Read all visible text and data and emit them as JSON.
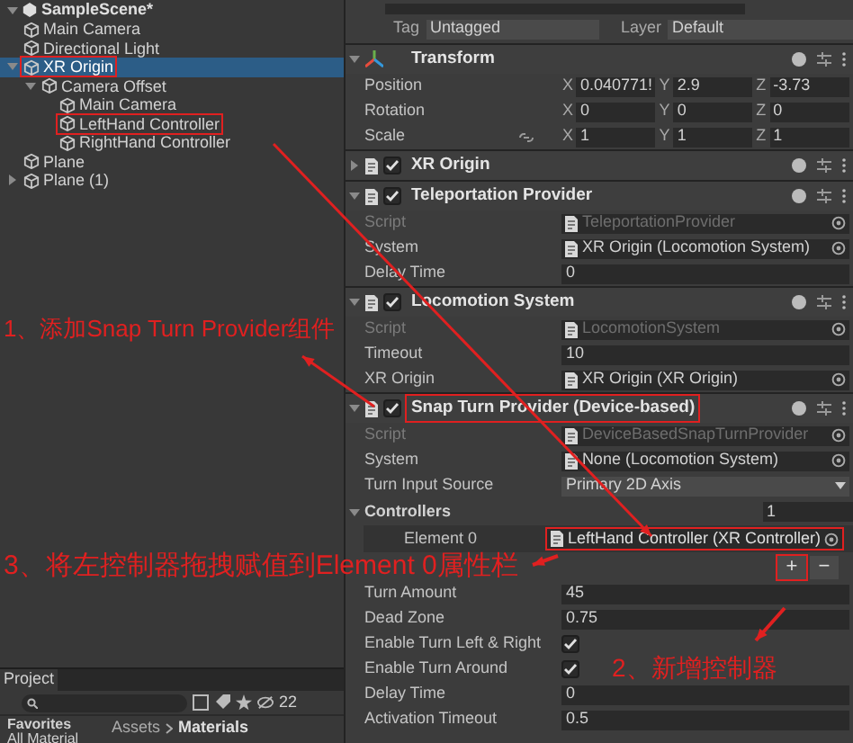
{
  "hierarchy": {
    "scene": "SampleScene*",
    "items": [
      {
        "label": "Main Camera",
        "selected": false,
        "annotated": false
      },
      {
        "label": "Directional Light",
        "selected": false,
        "annotated": false
      },
      {
        "label": "XR Origin",
        "selected": true,
        "annotated": true,
        "expanded": true,
        "children": [
          {
            "label": "Camera Offset",
            "selected": false,
            "annotated": false,
            "expanded": true,
            "children": [
              {
                "label": "Main Camera",
                "selected": false,
                "annotated": false
              },
              {
                "label": "LeftHand Controller",
                "selected": false,
                "annotated": true
              },
              {
                "label": "RightHand Controller",
                "selected": false,
                "annotated": false
              }
            ]
          }
        ]
      },
      {
        "label": "Plane",
        "selected": false,
        "annotated": false
      },
      {
        "label": "Plane (1)",
        "selected": false,
        "annotated": false,
        "expanded": false
      }
    ]
  },
  "inspector": {
    "tag_label": "Tag",
    "tag_value": "Untagged",
    "layer_label": "Layer",
    "layer_value": "Default",
    "components": [
      {
        "kind": "transform",
        "title": "Transform",
        "expanded": true,
        "annotated": false,
        "rows": [
          {
            "label": "Position",
            "linked": false,
            "values": [
              {
                "axis": "X",
                "value": "0.040771!"
              },
              {
                "axis": "Y",
                "value": "2.9"
              },
              {
                "axis": "Z",
                "value": "-3.73"
              }
            ]
          },
          {
            "label": "Rotation",
            "linked": false,
            "values": [
              {
                "axis": "X",
                "value": "0"
              },
              {
                "axis": "Y",
                "value": "0"
              },
              {
                "axis": "Z",
                "value": "0"
              }
            ]
          },
          {
            "label": "Scale",
            "linked": true,
            "values": [
              {
                "axis": "X",
                "value": "1"
              },
              {
                "axis": "Y",
                "value": "1"
              },
              {
                "axis": "Z",
                "value": "1"
              }
            ]
          }
        ]
      },
      {
        "kind": "script",
        "title": "XR Origin",
        "enabled": true,
        "expanded": false,
        "annotated": false
      },
      {
        "kind": "script",
        "title": "Teleportation Provider",
        "enabled": true,
        "expanded": true,
        "annotated": false,
        "fields": [
          {
            "kind": "object",
            "label": "Script",
            "value": "TeleportationProvider",
            "disabled": true
          },
          {
            "kind": "object",
            "label": "System",
            "value": "XR Origin (Locomotion System)",
            "disabled": false
          },
          {
            "kind": "text",
            "label": "Delay Time",
            "value": "0"
          }
        ]
      },
      {
        "kind": "script",
        "title": "Locomotion System",
        "enabled": true,
        "expanded": true,
        "annotated": false,
        "fields": [
          {
            "kind": "object",
            "label": "Script",
            "value": "LocomotionSystem",
            "disabled": true
          },
          {
            "kind": "text",
            "label": "Timeout",
            "value": "10"
          },
          {
            "kind": "object",
            "label": "XR Origin",
            "value": "XR Origin (XR Origin)",
            "disabled": false
          }
        ]
      },
      {
        "kind": "script",
        "title": "Snap Turn Provider (Device-based)",
        "enabled": true,
        "expanded": true,
        "annotated": true,
        "fields": [
          {
            "kind": "object",
            "label": "Script",
            "value": "DeviceBasedSnapTurnProvider",
            "disabled": true
          },
          {
            "kind": "object",
            "label": "System",
            "value": "None (Locomotion System)",
            "disabled": false
          },
          {
            "kind": "dropdown",
            "label": "Turn Input Source",
            "value": "Primary 2D Axis"
          },
          {
            "kind": "list",
            "label": "Controllers",
            "expanded": true,
            "count": "1",
            "elements": [
              {
                "label": "Element 0",
                "value": "LeftHand Controller (XR Controller)",
                "annotated": true
              }
            ],
            "add": "+",
            "remove": "−",
            "add_annotated": true
          },
          {
            "kind": "text",
            "label": "Turn Amount",
            "value": "45"
          },
          {
            "kind": "text",
            "label": "Dead Zone",
            "value": "0.75"
          },
          {
            "kind": "checkbox",
            "label": "Enable Turn Left & Right",
            "checked": true
          },
          {
            "kind": "checkbox",
            "label": "Enable Turn Around",
            "checked": true
          },
          {
            "kind": "text",
            "label": "Delay Time",
            "value": "0"
          },
          {
            "kind": "text",
            "label": "Activation Timeout",
            "value": "0.5"
          }
        ]
      }
    ]
  },
  "project": {
    "tab": "Project",
    "count": "22",
    "favorites": "Favorites",
    "favorite_item": "All Material",
    "breadcrumb": [
      "Assets",
      "Materials"
    ]
  },
  "annotations": [
    {
      "text": "1、添加Snap Turn Provider组件"
    },
    {
      "text": "3、将左控制器拖拽赋值到Element 0属性栏"
    },
    {
      "text": "2、新增控制器"
    }
  ]
}
